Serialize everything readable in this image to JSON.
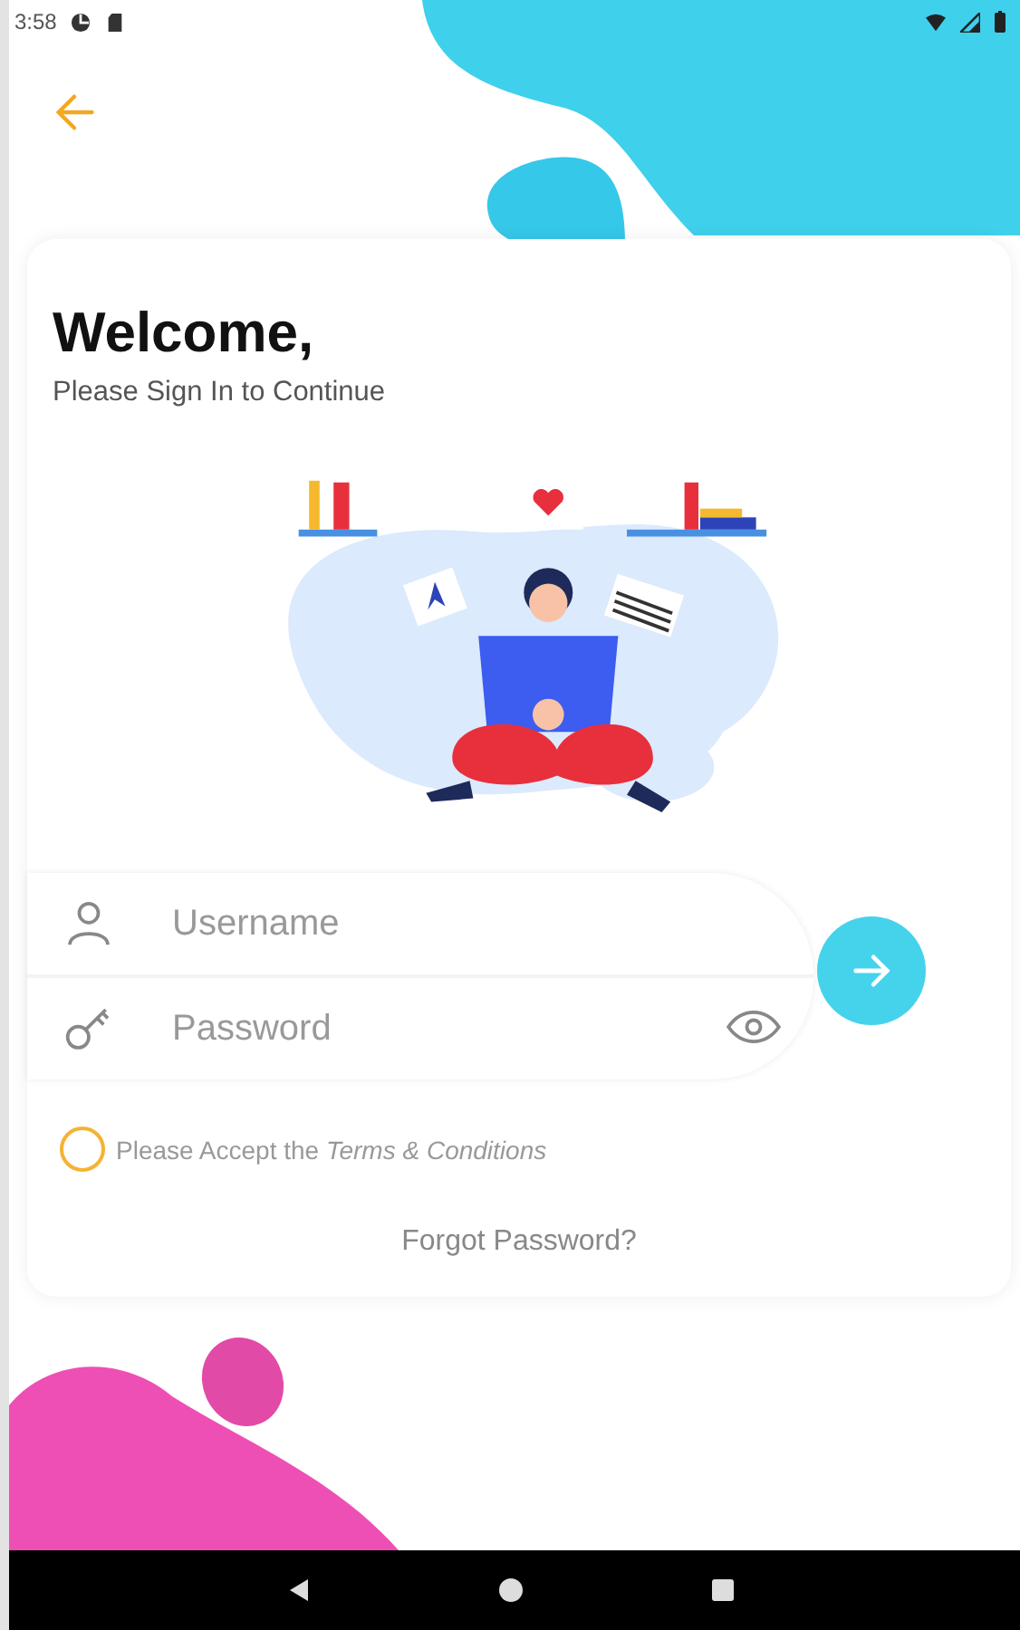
{
  "status_bar": {
    "time": "3:58"
  },
  "header": {
    "title": "Welcome,",
    "subtitle": "Please Sign In to Continue"
  },
  "form": {
    "fields": [
      {
        "kind": "username",
        "placeholder": "Username"
      },
      {
        "kind": "password",
        "placeholder": "Password"
      }
    ],
    "terms": {
      "text": "Please Accept the *Terms & Conditions*",
      "checked": false
    },
    "forgot_link": "Forgot Password?"
  }
}
